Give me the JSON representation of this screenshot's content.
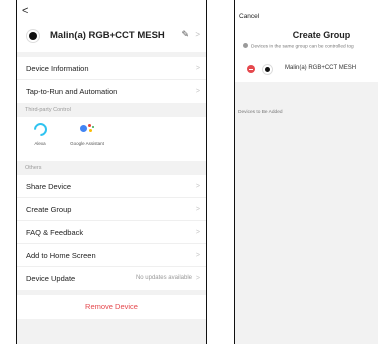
{
  "left": {
    "back_glyph": "<",
    "device_name": "Malin(a) RGB+CCT MESH",
    "edit_glyph": "✎",
    "chevron": ">",
    "group1": [
      {
        "label": "Device Information"
      },
      {
        "label": "Tap-to-Run and Automation"
      }
    ],
    "third_party_label": "Third-party Control",
    "third_party": [
      {
        "label": "Alexa",
        "icon": "alexa-icon"
      },
      {
        "label": "Google Assistant",
        "icon": "google-assistant-icon"
      }
    ],
    "others_label": "Others",
    "group2": [
      {
        "label": "Share Device"
      },
      {
        "label": "Create Group"
      },
      {
        "label": "FAQ & Feedback"
      },
      {
        "label": "Add to Home Screen"
      },
      {
        "label": "Device Update",
        "value": "No updates available"
      }
    ],
    "remove_label": "Remove Device"
  },
  "right": {
    "cancel_label": "Cancel",
    "title": "Create Group",
    "info_text": "Devices in the same group can be controlled tog",
    "device_name": "Malin(a) RGB+CCT MESH",
    "to_add_label": "Devices to Be Added"
  },
  "colors": {
    "accent_red": "#e5484d",
    "alexa_blue": "#2fc3f0",
    "background_gray": "#f2f2f2"
  }
}
